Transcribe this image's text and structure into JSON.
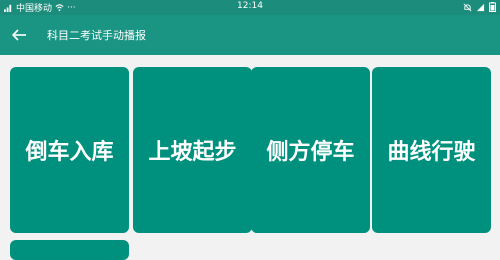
{
  "status_bar": {
    "carrier": "中国移动",
    "more": "···",
    "time": "12:14"
  },
  "app_bar": {
    "title": "科目二考试手动播报",
    "back_icon": "arrow-left-icon"
  },
  "tiles": [
    {
      "label": "倒车入库"
    },
    {
      "label": "上坡起步"
    },
    {
      "label": "侧方停车"
    },
    {
      "label": "曲线行驶"
    },
    {
      "label": ""
    }
  ],
  "colors": {
    "status_bar": "#1c8d7c",
    "app_bar": "#1a9483",
    "tile": "#00907e",
    "background": "#f2f2f2"
  }
}
